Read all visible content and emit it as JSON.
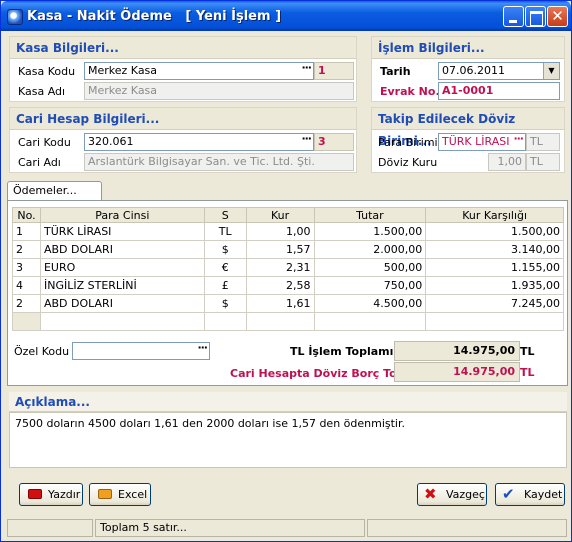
{
  "window": {
    "title": "Kasa - Nakit Ödeme   [ Yeni İşlem ]"
  },
  "kasa": {
    "section_title": "Kasa Bilgileri...",
    "kod_label": "Kasa Kodu",
    "kod_value": "Merkez Kasa",
    "kod_index": "1",
    "adi_label": "Kasa Adı",
    "adi_value": "Merkez Kasa"
  },
  "islem": {
    "section_title": "İşlem Bilgileri...",
    "tarih_label": "Tarih",
    "tarih_value": "07.06.2011",
    "evrak_label": "Evrak No.",
    "evrak_value": "A1-0001"
  },
  "cari": {
    "section_title": "Cari Hesap Bilgileri...",
    "kod_label": "Cari Kodu",
    "kod_value": "320.061",
    "kod_index": "3",
    "adi_label": "Cari Adı",
    "adi_value": "Arslantürk Bilgisayar San. ve Tic. Ltd. Şti."
  },
  "doviz": {
    "section_title": "Takip Edilecek Döviz Birimi...",
    "para_label": "Para Birimi",
    "para_value": "TÜRK LİRASI",
    "para_symbol": "TL",
    "kur_label": "Döviz Kuru",
    "kur_value": "1,00",
    "kur_symbol": "TL"
  },
  "tab": {
    "label": "Ödemeler..."
  },
  "grid": {
    "headers": [
      "No.",
      "Para Cinsi",
      "S",
      "Kur",
      "Tutar",
      "Kur Karşılığı"
    ],
    "rows": [
      [
        "1",
        "TÜRK LİRASI",
        "TL",
        "1,00",
        "1.500,00",
        "1.500,00"
      ],
      [
        "2",
        "ABD DOLARI",
        "$",
        "1,57",
        "2.000,00",
        "3.140,00"
      ],
      [
        "3",
        "EURO",
        "€",
        "2,31",
        "500,00",
        "1.155,00"
      ],
      [
        "4",
        "İNGİLİZ STERLİNİ",
        "£",
        "2,58",
        "750,00",
        "1.935,00"
      ],
      [
        "2",
        "ABD DOLARI",
        "$",
        "1,61",
        "4.500,00",
        "7.245,00"
      ]
    ]
  },
  "totals": {
    "ozel_kod_label": "Özel Kodu",
    "ozel_kod_value": "",
    "tl_label": "TL İşlem Toplamı",
    "tl_value": "14.975,00",
    "tl_currency": "TL",
    "borc_label": "Cari Hesapta Döviz Borç Toplamı",
    "borc_value": "14.975,00",
    "borc_currency": "TL"
  },
  "aciklama": {
    "section_title": "Açıklama...",
    "text": "7500 doların 4500 doları 1,61 den 2000 doları ise 1,57 den ödenmiştir."
  },
  "buttons": {
    "yazdir": "Yazdır",
    "excel": "Excel",
    "vazgec": "Vazgeç",
    "kaydet": "Kaydet"
  },
  "status": {
    "row_count": "Toplam 5 satır..."
  },
  "colors": {
    "title_blue": "#1f4cb5",
    "accent_red": "#c01050"
  }
}
